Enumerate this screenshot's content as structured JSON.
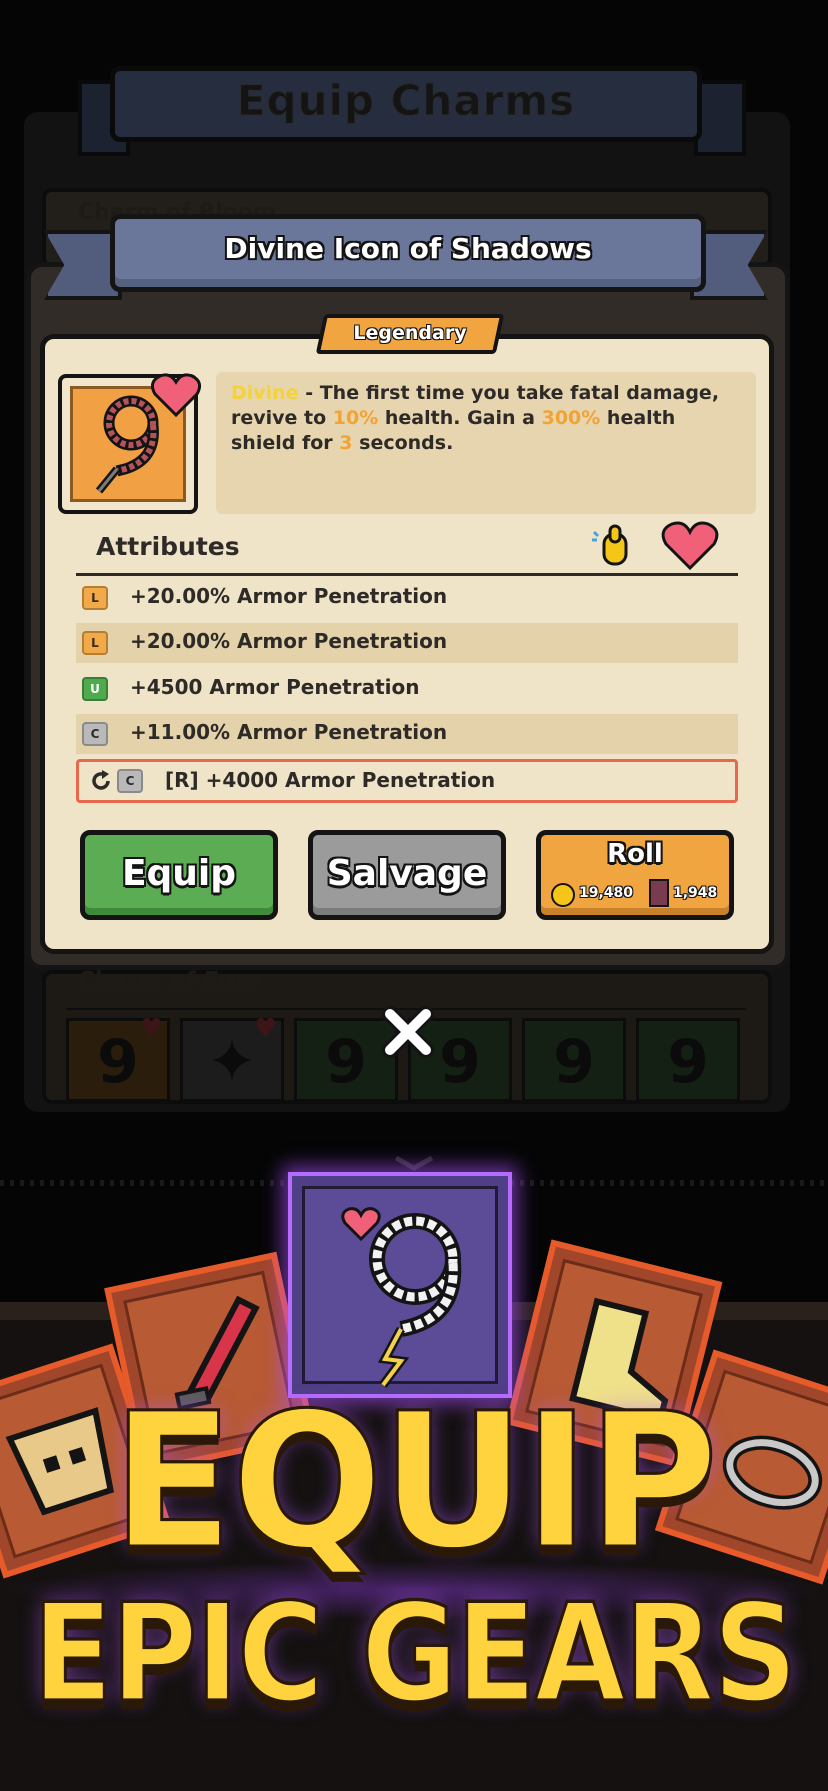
{
  "background": {
    "banner_title": "Equip Charms",
    "top_card_title": "Charm of Bloom",
    "fury_title": "Charm of Fury"
  },
  "modal": {
    "title": "Divine Icon of Shadows",
    "rarity": "Legendary",
    "description": {
      "keyword": "Divine",
      "part1": " - The first time you take fatal damage, revive to ",
      "revive_pct": "10%",
      "part2": " health. Gain a ",
      "shield_pct": "300%",
      "part3": " health shield for ",
      "seconds": "3",
      "part4": " seconds."
    },
    "attributes_title": "Attributes",
    "attributes": [
      {
        "tag": "L",
        "tier": "legendary",
        "text": "+20.00% Armor Penetration"
      },
      {
        "tag": "L",
        "tier": "legendary",
        "text": "+20.00% Armor Penetration"
      },
      {
        "tag": "U",
        "tier": "uncommon",
        "text": "+4500 Armor Penetration"
      },
      {
        "tag": "C",
        "tier": "common",
        "text": "+11.00% Armor Penetration"
      },
      {
        "tag": "C",
        "tier": "common",
        "text": "[R] +4000 Armor Penetration",
        "selected": true
      }
    ],
    "buttons": {
      "equip": "Equip",
      "salvage": "Salvage",
      "roll": "Roll",
      "roll_gold_cost": "19,480",
      "roll_book_cost": "1,948"
    }
  },
  "promo": {
    "line1": "EQUIP",
    "line2": "EPIC GEARS"
  },
  "colors": {
    "legendary": "#f0a540",
    "uncommon": "#4eaa4c",
    "common": "#b9b9b9",
    "card_bg": "#efe4c8",
    "ribbon": "#6b779a",
    "promo_text": "#ffd33d"
  },
  "icons": [
    "rosary-charm-icon",
    "heart-icon",
    "praying-hand-icon",
    "reroll-icon",
    "gold-coin-icon",
    "book-icon",
    "close-icon"
  ]
}
